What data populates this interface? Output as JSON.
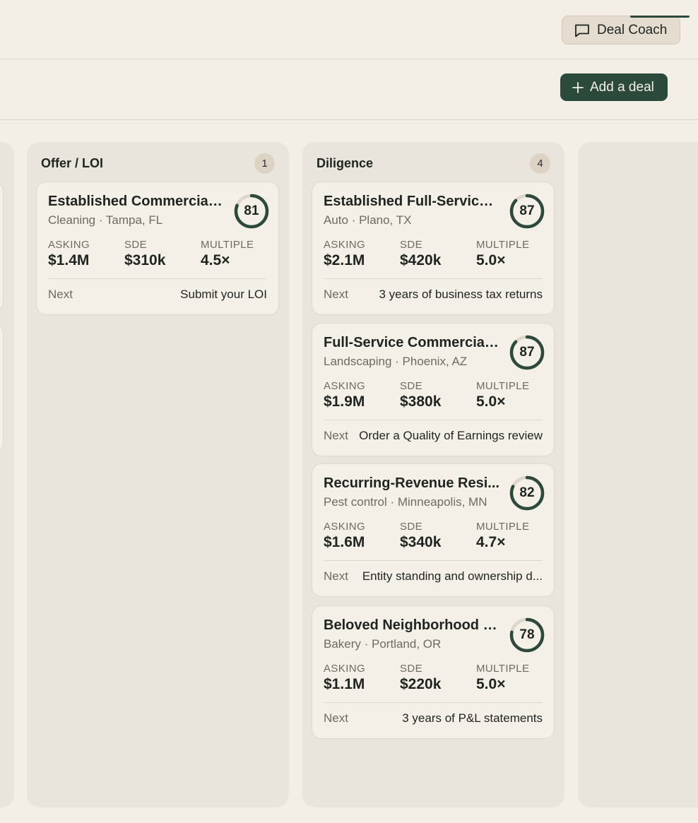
{
  "header": {
    "coach_label": "Deal Coach"
  },
  "toolbar": {
    "add_label": "Add a deal"
  },
  "columns": [
    {
      "title": "Offer / LOI",
      "count": "1",
      "cards": [
        {
          "title": "Established Commercial ...",
          "subtitle": "Cleaning · Tampa, FL",
          "score": "81",
          "score_pct": 0.81,
          "asking_label": "ASKING",
          "asking": "$1.4M",
          "sde_label": "SDE",
          "sde": "$310k",
          "multiple_label": "MULTIPLE",
          "multiple": "4.5×",
          "next_label": "Next",
          "next": "Submit your LOI"
        }
      ]
    },
    {
      "title": "Diligence",
      "count": "4",
      "cards": [
        {
          "title": "Established Full-Service ...",
          "subtitle": "Auto · Plano, TX",
          "score": "87",
          "score_pct": 0.87,
          "asking_label": "ASKING",
          "asking": "$2.1M",
          "sde_label": "SDE",
          "sde": "$420k",
          "multiple_label": "MULTIPLE",
          "multiple": "5.0×",
          "next_label": "Next",
          "next": "3 years of business tax returns"
        },
        {
          "title": "Full-Service Commercial ...",
          "subtitle": "Landscaping · Phoenix, AZ",
          "score": "87",
          "score_pct": 0.87,
          "asking_label": "ASKING",
          "asking": "$1.9M",
          "sde_label": "SDE",
          "sde": "$380k",
          "multiple_label": "MULTIPLE",
          "multiple": "5.0×",
          "next_label": "Next",
          "next": "Order a Quality of Earnings review"
        },
        {
          "title": "Recurring-Revenue Resi...",
          "subtitle": "Pest control · Minneapolis, MN",
          "score": "82",
          "score_pct": 0.82,
          "asking_label": "ASKING",
          "asking": "$1.6M",
          "sde_label": "SDE",
          "sde": "$340k",
          "multiple_label": "MULTIPLE",
          "multiple": "4.7×",
          "next_label": "Next",
          "next": "Entity standing and ownership d..."
        },
        {
          "title": "Beloved Neighborhood B...",
          "subtitle": "Bakery · Portland, OR",
          "score": "78",
          "score_pct": 0.78,
          "asking_label": "ASKING",
          "asking": "$1.1M",
          "sde_label": "SDE",
          "sde": "$220k",
          "multiple_label": "MULTIPLE",
          "multiple": "5.0×",
          "next_label": "Next",
          "next": "3 years of P&L statements"
        }
      ]
    }
  ],
  "colors": {
    "accent": "#2b4a3c",
    "ring_track": "#ddd6c9",
    "background": "#f4efe6"
  }
}
